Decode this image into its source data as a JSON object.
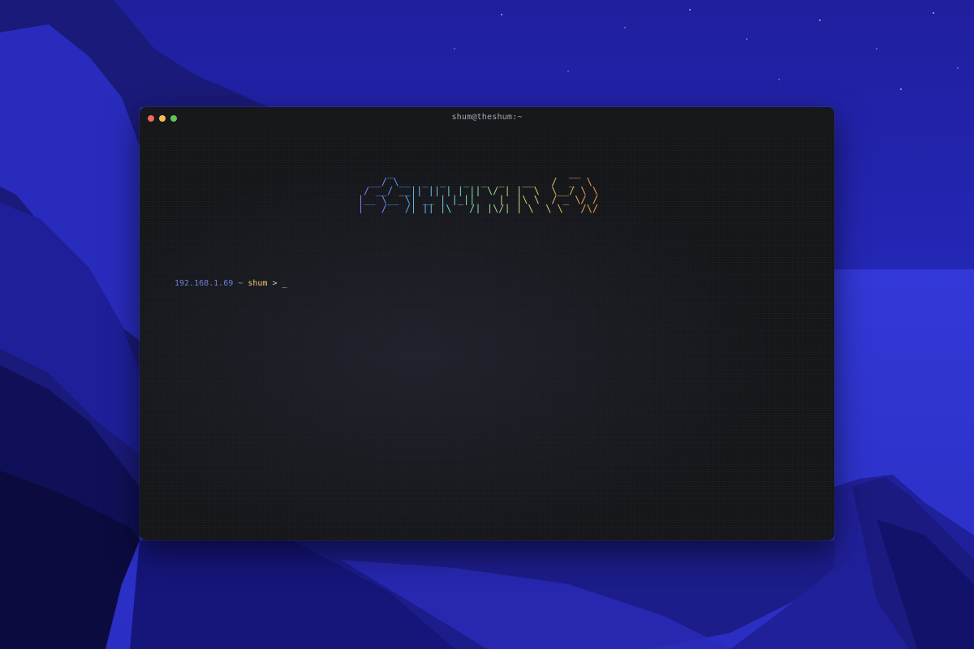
{
  "window": {
    "title": "shum@theshum:~"
  },
  "terminal": {
    "ascii_banner": "         _                              __\n      __/ \\__  _  _   _  _  _   __   /  _  \\\n     / __/ __|| || | | || \\/ | |  \\  \\__/ \\ \\\n    |__ \\__ \\| __ | |_||    |  |\\ \\  / _ \\/ /\n    |___/___/|_||_|\\___/|_|\\/|_| \\__\\ \\___/\\/ ",
    "prompt": {
      "ip": "192.168.1.69",
      "separator": "~",
      "user": "shum",
      "symbol": ">",
      "cursor": "_"
    }
  },
  "colors": {
    "window_bg": "#141519",
    "titlebar_bg": "#17181c",
    "close": "#ec6a5e",
    "minimize": "#f4bf4f",
    "zoom": "#61c554",
    "prompt_ip": "#6f7fd8",
    "prompt_user": "#f2c46d",
    "desktop_sky": "#2a2fd0"
  }
}
